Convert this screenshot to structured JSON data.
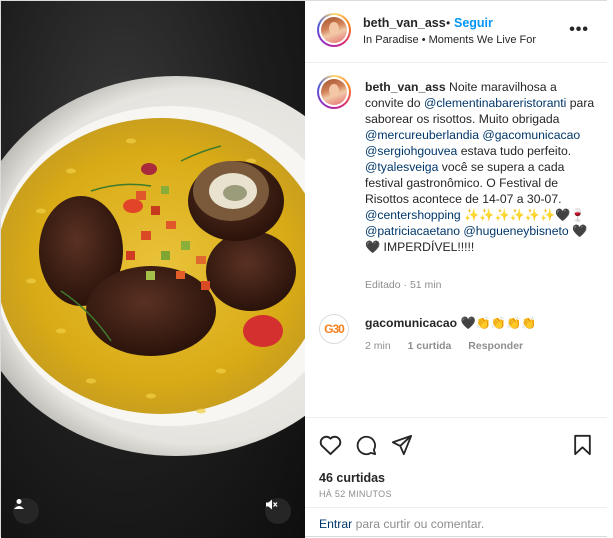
{
  "post": {
    "username": "beth_van_ass",
    "dot": "•",
    "follow_label": "Seguir",
    "location": "In Paradise • Moments We Live For",
    "more_label": "•••"
  },
  "caption": {
    "username": "beth_van_ass",
    "p1": " Noite maravilhosa a convite do ",
    "m1": "@clementinabareristoranti",
    "p2": " para saborear os risottos. Muito obrigada ",
    "m2": "@mercureuberlandia",
    "p3": " ",
    "m3": "@gacomunicacao",
    "p4": " ",
    "m4": "@sergiohgouvea",
    "p5": " estava tudo perfeito. ",
    "m5": "@tyalesveiga",
    "p6": " você se supera a cada festival gastronômico. O Festival de Risottos acontece de 14-07 a 30-07. ",
    "m6": "@centershopping",
    "p7": " ✨✨✨✨✨✨🖤🍷 ",
    "m7": "@patriciacaetano",
    "p8": " ",
    "m8": "@hugueneybisneto",
    "p9": " 🖤🖤 IMPERDÍVEL!!!!!",
    "meta": "Editado · 51 min"
  },
  "comment": {
    "logo": "G30",
    "username": "gacomunicacao",
    "text": " 🖤👏👏👏👏",
    "time": "2 min",
    "likes": "1 curtida",
    "reply": "Responder"
  },
  "actions": {
    "icons": [
      "heart-icon",
      "comment-icon",
      "share-icon",
      "bookmark-icon"
    ],
    "likes": "46 curtidas",
    "time": "HÁ 52 MINUTOS"
  },
  "add_comment": {
    "enter": "Entrar",
    "rest": " para curtir ou comentar."
  },
  "colors": {
    "link": "#0095f6",
    "mention": "#00376b",
    "muted": "#8e8e8e",
    "risotto": "#e1b51c"
  }
}
